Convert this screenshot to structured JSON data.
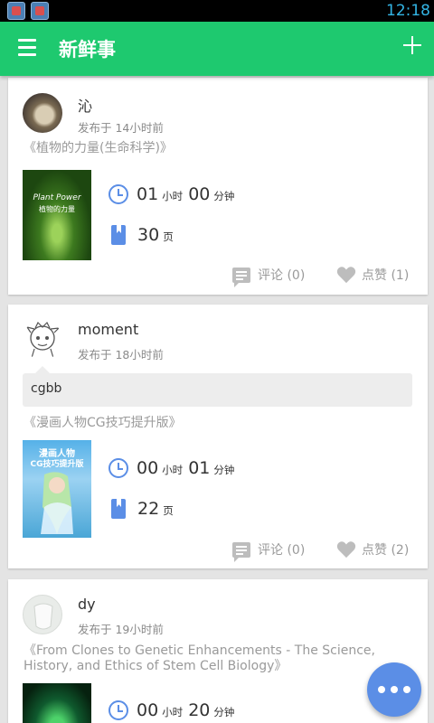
{
  "status_bar": {
    "time": "12:18"
  },
  "app_bar": {
    "title": "新鲜事"
  },
  "posts": [
    {
      "username": "沁",
      "post_time": "发布于 14小时前",
      "book_title": "《植物的力量(生命科学)》",
      "cover_text_top": "Plant Power",
      "cover_text_bottom": "植物的力量",
      "duration_hours": "01",
      "hours_unit": "小时",
      "duration_minutes": "00",
      "minutes_unit": "分钟",
      "pages": "30",
      "pages_unit": "页",
      "comment_label": "评论 (0)",
      "like_label": "点赞 (1)"
    },
    {
      "username": "moment",
      "post_time": "发布于 18小时前",
      "quote": "cgbb",
      "book_title": "《漫画人物CG技巧提升版》",
      "cover_text_top": "漫画人物",
      "cover_text_bottom": "CG技巧提升版",
      "duration_hours": "00",
      "hours_unit": "小时",
      "duration_minutes": "01",
      "minutes_unit": "分钟",
      "pages": "22",
      "pages_unit": "页",
      "comment_label": "评论 (0)",
      "like_label": "点赞 (2)"
    },
    {
      "username": "dy",
      "post_time": "发布于 19小时前",
      "book_title": "《From Clones to Genetic Enhancements - The Science, History, and Ethics of Stem Cell Biology》",
      "duration_hours": "00",
      "hours_unit": "小时",
      "duration_minutes": "20",
      "minutes_unit": "分钟"
    }
  ],
  "colors": {
    "app_bar": "#1ec96f",
    "accent_blue": "#5b8ee6",
    "background": "#e4e4e4"
  },
  "icons": [
    "menu-icon",
    "add-icon",
    "clock-icon",
    "book-icon",
    "comment-icon",
    "heart-icon",
    "more-icon"
  ]
}
